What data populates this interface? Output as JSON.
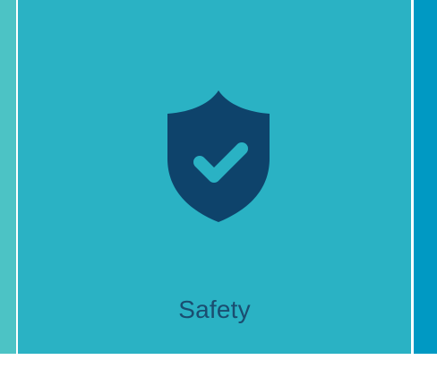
{
  "tile": {
    "label": "Safety",
    "icon": "shield-check-icon"
  },
  "colors": {
    "left_panel": "#4cc3c5",
    "main_panel": "#2ab2c4",
    "right_panel": "#0099c3",
    "shield": "#0e436b",
    "check": "#2ab2c4",
    "label_text": "#1a4d70"
  }
}
